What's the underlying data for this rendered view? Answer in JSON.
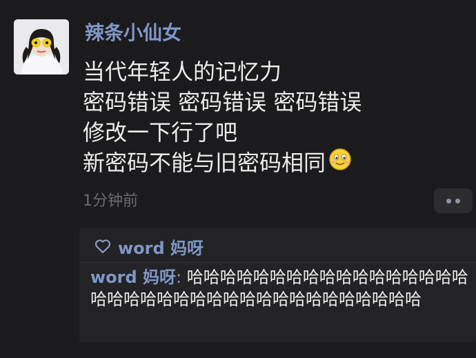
{
  "post": {
    "author": "辣条小仙女",
    "lines": [
      "当代年轻人的记忆力",
      "密码错误 密码错误 密码错误",
      "修改一下行了吧",
      "新密码不能与旧密码相同"
    ],
    "time": "1分钟前"
  },
  "likes": {
    "names": "word 妈呀"
  },
  "comment": {
    "author": "word 妈呀",
    "separator": ": ",
    "text": "哈哈哈哈哈哈哈哈哈哈哈哈哈哈哈哈哈哈哈哈哈哈哈哈哈哈哈哈哈哈哈哈哈哈哈哈哈"
  },
  "icons": {
    "like": "heart-icon",
    "more": "more-dots-icon",
    "emoji": "smile-emoji-icon"
  },
  "colors": {
    "background": "#1b1b1d",
    "name_link": "#7f97c7",
    "text": "#ececec",
    "muted": "#6d6d70",
    "panel": "#232325"
  }
}
